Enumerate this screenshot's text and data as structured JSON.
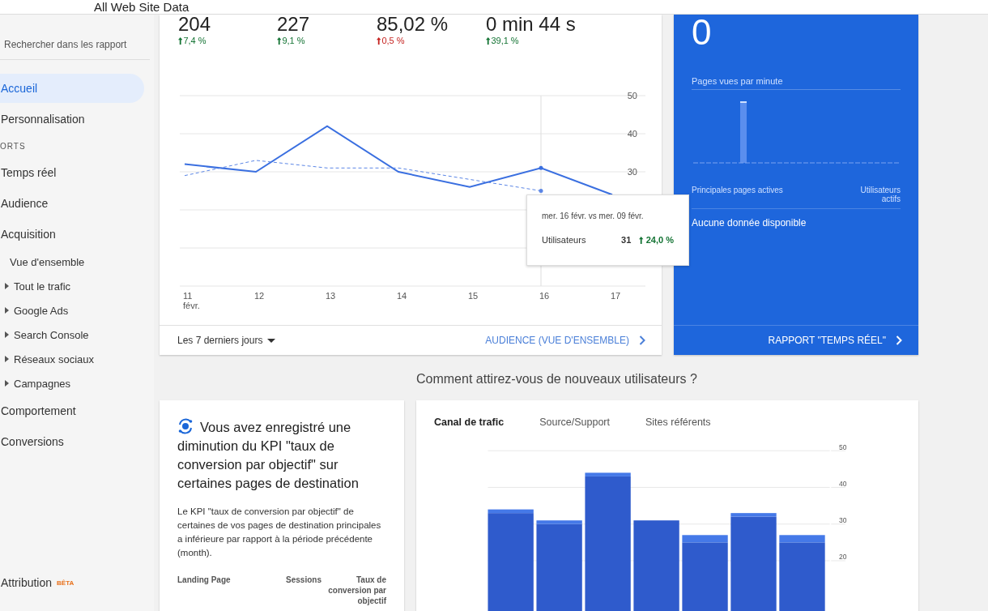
{
  "header": {
    "title": "All Web Site Data"
  },
  "sidebar": {
    "search": {
      "placeholder": "Rechercher dans les rapport"
    },
    "items": [
      {
        "kind": "item",
        "label": "Accueil",
        "selected": true
      },
      {
        "kind": "item",
        "label": "Personnalisation",
        "selected": false
      },
      {
        "kind": "section",
        "label": "ORTS"
      },
      {
        "kind": "item",
        "label": "Temps réel",
        "selected": false
      },
      {
        "kind": "item",
        "label": "Audience",
        "selected": false
      },
      {
        "kind": "item",
        "label": "Acquisition",
        "selected": false,
        "children": [
          {
            "label": "Vue d'ensemble",
            "expandable": false
          },
          {
            "label": "Tout le trafic",
            "expandable": true
          },
          {
            "label": "Google Ads",
            "expandable": true
          },
          {
            "label": "Search Console",
            "expandable": true
          },
          {
            "label": "Réseaux sociaux",
            "expandable": true
          },
          {
            "label": "Campagnes",
            "expandable": true
          }
        ]
      },
      {
        "kind": "item",
        "label": "Comportement",
        "selected": false
      },
      {
        "kind": "item",
        "label": "Conversions",
        "selected": false
      }
    ],
    "bottom_items": [
      {
        "label": "Attribution",
        "badge": "BÊTA",
        "selected": false
      }
    ]
  },
  "overview": {
    "metrics": [
      {
        "value": "204",
        "change": "7,4 %",
        "color": "#137333"
      },
      {
        "value": "227",
        "change": "9,1 %",
        "color": "#137333"
      },
      {
        "value": "85,02 %",
        "change": "0,5 %",
        "color": "#c5221f"
      },
      {
        "value": "0 min 44 s",
        "change": "39,1 %",
        "color": "#137333"
      }
    ],
    "chart_data": {
      "type": "line",
      "categories": [
        "11 févr.",
        "12",
        "13",
        "14",
        "15",
        "16",
        "17"
      ],
      "ylim": [
        0,
        50
      ],
      "yticks": [
        30,
        40,
        50
      ],
      "series": [
        {
          "color": "#3a6fe0",
          "values": [
            32,
            30,
            42,
            30,
            26,
            31,
            24
          ]
        },
        {
          "color": "#5b86e6",
          "line_style": "dashed",
          "values": [
            29,
            33,
            31,
            31,
            28,
            25,
            null
          ]
        }
      ],
      "grid": true,
      "ref_lines": [
        {
          "axis": "x",
          "value": "16",
          "color": "#dddddd"
        }
      ]
    },
    "hover": {
      "title": "mer. 16 févr. vs mer. 09 févr.",
      "label": "Utilisateurs",
      "value": "31",
      "change": "24,0 %"
    },
    "range": "Les 7 derniers jours",
    "link": "AUDIENCE (VUE D'ENSEMBLE)"
  },
  "realtime": {
    "value": "0",
    "chart_label": "Pages vues par minute",
    "columns": [
      "Principales pages actives",
      "Utilisateurs actifs"
    ],
    "empty_text": "Aucune donnée disponible",
    "link": "RAPPORT \"TEMPS RÉEL\""
  },
  "acquisition": {
    "heading": "Comment attirez-vous de nouveaux utilisateurs ?",
    "insight": {
      "title": "Vous avez enregistré une diminution du KPI \"taux de conversion par objectif\" sur certaines pages de destination",
      "text": "Le KPI \"taux de conversion par objectif\" de certaines de vos pages de destination principales a inférieure par rapport à la période précédente (month).",
      "columns": [
        "Landing Page",
        "Sessions",
        "Taux de conversion par objectif"
      ]
    },
    "tabs": [
      {
        "label": "Canal de trafic",
        "selected": true
      },
      {
        "label": "Source/Support",
        "selected": false
      },
      {
        "label": "Sites référents",
        "selected": false
      }
    ],
    "chart_data": {
      "type": "bar",
      "stacked": true,
      "grid": true,
      "ylim": [
        0,
        50
      ],
      "yticks": [
        20,
        30,
        40,
        50
      ],
      "series": [
        {
          "color": "#2f5bcc",
          "values": [
            33,
            30,
            43,
            31,
            25,
            32,
            25
          ]
        },
        {
          "color": "#4579e8",
          "values": [
            1,
            1,
            1,
            0,
            2,
            1,
            2
          ]
        }
      ]
    }
  }
}
